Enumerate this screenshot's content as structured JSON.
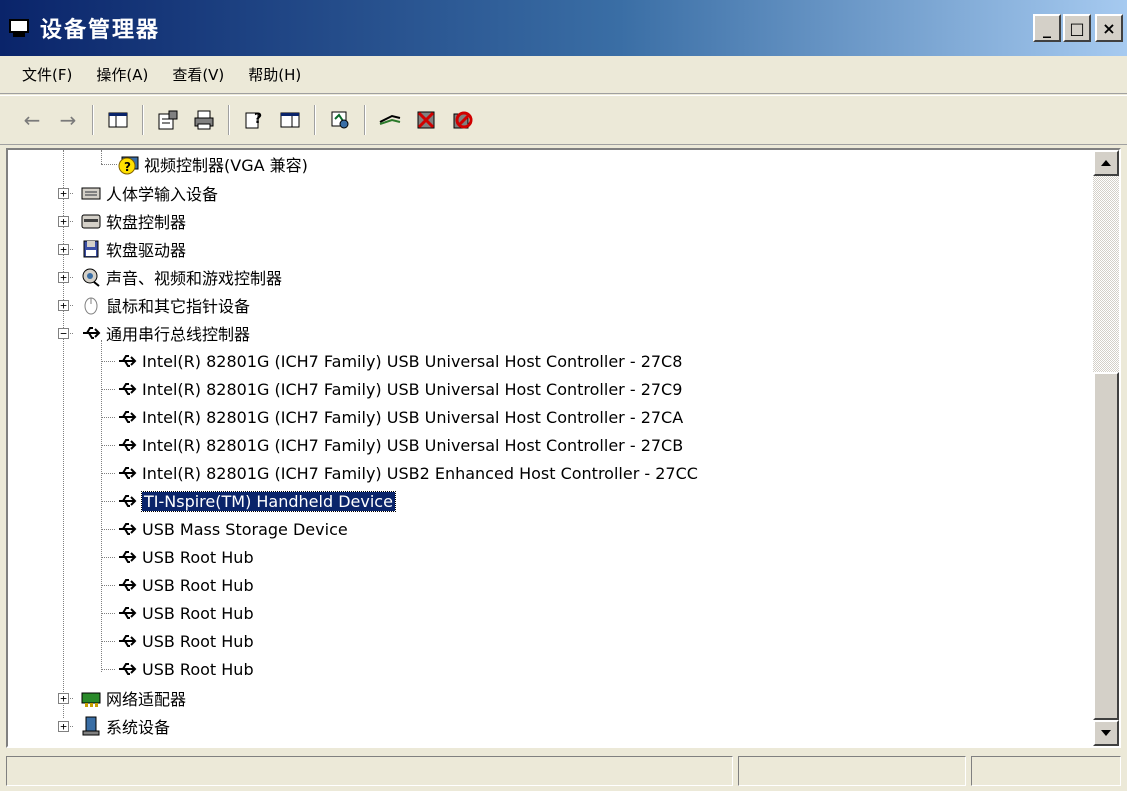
{
  "window": {
    "title": "设备管理器"
  },
  "title_buttons": {
    "minimize": "_",
    "maximize": "□",
    "close": "×"
  },
  "menu": [
    {
      "label": "文件(F)"
    },
    {
      "label": "操作(A)"
    },
    {
      "label": "查看(V)"
    },
    {
      "label": "帮助(H)"
    }
  ],
  "toolbar": {
    "buttons": [
      "back-icon",
      "forward-icon",
      "console-tree-icon",
      "properties-icon",
      "print-icon",
      "help-icon",
      "action-pane-icon",
      "scan-hardware-icon",
      "update-driver-icon",
      "uninstall-icon",
      "disable-icon"
    ]
  },
  "tree": {
    "top_item": {
      "label": "视频控制器(VGA 兼容)"
    },
    "categories": [
      {
        "label": "人体学输入设备"
      },
      {
        "label": "软盘控制器"
      },
      {
        "label": "软盘驱动器"
      },
      {
        "label": "声音、视频和游戏控制器"
      },
      {
        "label": "鼠标和其它指针设备"
      },
      {
        "label": "通用串行总线控制器"
      }
    ],
    "usb_children": [
      {
        "label": "Intel(R) 82801G (ICH7 Family) USB Universal Host Controller - 27C8"
      },
      {
        "label": "Intel(R) 82801G (ICH7 Family) USB Universal Host Controller - 27C9"
      },
      {
        "label": "Intel(R) 82801G (ICH7 Family) USB Universal Host Controller - 27CA"
      },
      {
        "label": "Intel(R) 82801G (ICH7 Family) USB Universal Host Controller - 27CB"
      },
      {
        "label": "Intel(R) 82801G (ICH7 Family) USB2 Enhanced Host Controller - 27CC"
      },
      {
        "label": "TI-Nspire(TM) Handheld Device"
      },
      {
        "label": "USB Mass Storage Device"
      },
      {
        "label": "USB Root Hub"
      },
      {
        "label": "USB Root Hub"
      },
      {
        "label": "USB Root Hub"
      },
      {
        "label": "USB Root Hub"
      },
      {
        "label": "USB Root Hub"
      }
    ],
    "bottom_categories": [
      {
        "label": "网络适配器"
      },
      {
        "label": "系统设备"
      }
    ],
    "selected": "TI-Nspire(TM) Handheld Device",
    "colors": {
      "selection": "#0a246a",
      "title_start": "#0a246a",
      "title_end": "#a6caf0"
    }
  }
}
